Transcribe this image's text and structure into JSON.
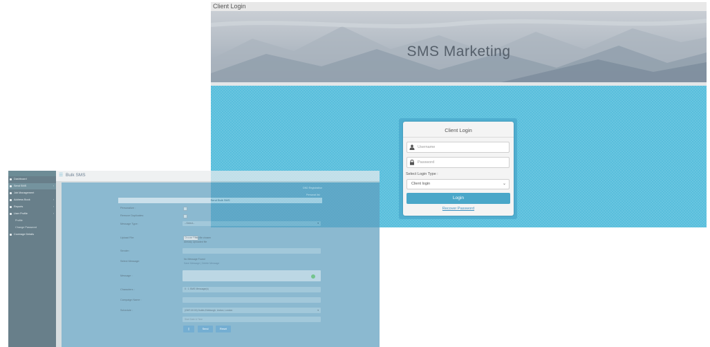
{
  "login_window": {
    "title": "Client Login",
    "banner_title": "SMS Marketing",
    "card": {
      "heading": "Client Login",
      "username_placeholder": "Username",
      "password_placeholder": "Password",
      "login_type_label": "Select Login Type :",
      "login_type_value": "Client login",
      "login_button": "Login",
      "recover_link": "Recover Password"
    },
    "colors": {
      "login_area": "#58bedc",
      "button": "#4aa7c9",
      "banner": "#b5bdc6"
    }
  },
  "dashboard": {
    "page_title": "Bulk SMS",
    "sidebar": {
      "items": [
        {
          "label": "Dashboard",
          "icon": "home-icon",
          "arrow": ""
        },
        {
          "label": "Send SMS",
          "icon": "send-icon",
          "arrow": "‹"
        },
        {
          "label": "Job Management",
          "icon": "briefcase-icon",
          "arrow": ""
        },
        {
          "label": "Address Book",
          "icon": "book-icon",
          "arrow": "‹"
        },
        {
          "label": "Reports",
          "icon": "chart-icon",
          "arrow": "‹"
        },
        {
          "label": "User Profile",
          "icon": "user-icon",
          "arrow": "‹"
        },
        {
          "label": "Profile",
          "icon": "",
          "arrow": ""
        },
        {
          "label": "Change Password",
          "icon": "",
          "arrow": ""
        },
        {
          "label": "Coverage Details",
          "icon": "globe-icon",
          "arrow": ""
        }
      ]
    },
    "right_links": [
      "DND Registration",
      "Personal list"
    ],
    "form": {
      "heading": "Send Bulk SMS",
      "personalize_label": "Personalize :",
      "remove_duplicates_label": "Remove Duplicates:",
      "message_type_label": "Message Type:",
      "message_type_value": "--Select--",
      "upload_file_label": "Upload File:",
      "choose_file_button": "Choose File",
      "no_file_text": "No file chosen",
      "already_uploaded_text": "Already Uploaded file",
      "sender_label": "Sender :",
      "select_message_label": "Select Message:",
      "no_message_text": "No Message Found",
      "save_delete_link": "Save Message | Delete Message",
      "message_label": "Message :",
      "characters_label": "Characters :",
      "characters_value": "0 : 1 SMS Message(s)",
      "campaign_label": "Campaign Name :",
      "schedule_label": "Schedule :",
      "timezone_value": "(GMT-00:00) Dublin,Edinburgh, Lisbon, London",
      "datetime_placeholder": "Start Date & Time",
      "send_button": "Send",
      "reset_button": "Reset"
    }
  }
}
